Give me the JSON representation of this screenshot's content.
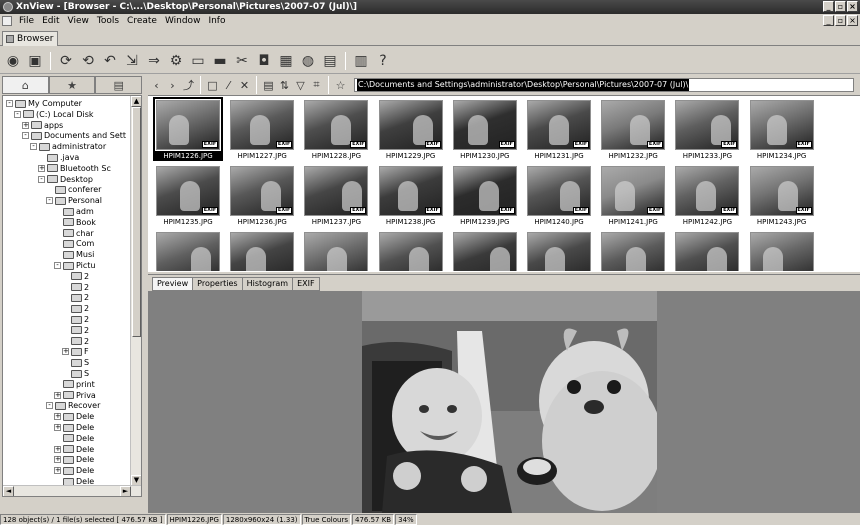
{
  "window": {
    "title": "XnView - [Browser - C:\\...\\Desktop\\Personal\\Pictures\\2007-07 (Jul)\\]"
  },
  "menu": [
    "File",
    "Edit",
    "View",
    "Tools",
    "Create",
    "Window",
    "Info"
  ],
  "doc_tab": "Browser",
  "path": "C:\\Documents and Settings\\administrator\\Desktop\\Personal\\Pictures\\2007-07 (Jul)\\",
  "tree": [
    {
      "label": "My Computer",
      "depth": 0,
      "exp": "-"
    },
    {
      "label": "(C:) Local Disk",
      "depth": 1,
      "exp": "-"
    },
    {
      "label": "apps",
      "depth": 2,
      "exp": "+"
    },
    {
      "label": "Documents and Sett",
      "depth": 2,
      "exp": "-"
    },
    {
      "label": "administrator",
      "depth": 3,
      "exp": "-"
    },
    {
      "label": ".java",
      "depth": 4,
      "exp": ""
    },
    {
      "label": "Bluetooth Sc",
      "depth": 4,
      "exp": "+"
    },
    {
      "label": "Desktop",
      "depth": 4,
      "exp": "-"
    },
    {
      "label": "conferer",
      "depth": 5,
      "exp": ""
    },
    {
      "label": "Personal",
      "depth": 5,
      "exp": "-"
    },
    {
      "label": "adm",
      "depth": 6,
      "exp": ""
    },
    {
      "label": "Book",
      "depth": 6,
      "exp": ""
    },
    {
      "label": "char",
      "depth": 6,
      "exp": ""
    },
    {
      "label": "Com",
      "depth": 6,
      "exp": ""
    },
    {
      "label": "Musi",
      "depth": 6,
      "exp": ""
    },
    {
      "label": "Pictu",
      "depth": 6,
      "exp": "-"
    },
    {
      "label": "2",
      "depth": 7,
      "exp": ""
    },
    {
      "label": "2",
      "depth": 7,
      "exp": ""
    },
    {
      "label": "2",
      "depth": 7,
      "exp": ""
    },
    {
      "label": "2",
      "depth": 7,
      "exp": ""
    },
    {
      "label": "2",
      "depth": 7,
      "exp": ""
    },
    {
      "label": "2",
      "depth": 7,
      "exp": ""
    },
    {
      "label": "2",
      "depth": 7,
      "exp": ""
    },
    {
      "label": "F",
      "depth": 7,
      "exp": "+"
    },
    {
      "label": "S",
      "depth": 7,
      "exp": ""
    },
    {
      "label": "S",
      "depth": 7,
      "exp": ""
    },
    {
      "label": "print",
      "depth": 6,
      "exp": ""
    },
    {
      "label": "Priva",
      "depth": 6,
      "exp": "+"
    },
    {
      "label": "Recover",
      "depth": 5,
      "exp": "-"
    },
    {
      "label": "Dele",
      "depth": 6,
      "exp": "+"
    },
    {
      "label": "Dele",
      "depth": 6,
      "exp": "+"
    },
    {
      "label": "Dele",
      "depth": 6,
      "exp": ""
    },
    {
      "label": "Dele",
      "depth": 6,
      "exp": "+"
    },
    {
      "label": "Dele",
      "depth": 6,
      "exp": "+"
    },
    {
      "label": "Dele",
      "depth": 6,
      "exp": "+"
    },
    {
      "label": "Dele",
      "depth": 6,
      "exp": ""
    }
  ],
  "thumbnails": [
    {
      "name": "HPIM1226.JPG",
      "tone": "#6c6c6c",
      "selected": true
    },
    {
      "name": "HPIM1227.JPG",
      "tone": "#5a5a5a"
    },
    {
      "name": "HPIM1228.JPG",
      "tone": "#4e4e4e"
    },
    {
      "name": "HPIM1229.JPG",
      "tone": "#3f3f3f"
    },
    {
      "name": "HPIM1230.JPG",
      "tone": "#2f2f2f"
    },
    {
      "name": "HPIM1231.JPG",
      "tone": "#4a4a4a"
    },
    {
      "name": "HPIM1232.JPG",
      "tone": "#7a7a7a"
    },
    {
      "name": "HPIM1233.JPG",
      "tone": "#5e5e5e"
    },
    {
      "name": "HPIM1234.JPG",
      "tone": "#6e6e6e"
    },
    {
      "name": "HPIM1235.JPG",
      "tone": "#4c4c4c"
    },
    {
      "name": "HPIM1236.JPG",
      "tone": "#585858"
    },
    {
      "name": "HPIM1237.JPG",
      "tone": "#464646"
    },
    {
      "name": "HPIM1238.JPG",
      "tone": "#3c3c3c"
    },
    {
      "name": "HPIM1239.JPG",
      "tone": "#2c2c2c"
    },
    {
      "name": "HPIM1240.JPG",
      "tone": "#555555"
    },
    {
      "name": "HPIM1241.JPG",
      "tone": "#8a8a8a"
    },
    {
      "name": "HPIM1242.JPG",
      "tone": "#626262"
    },
    {
      "name": "HPIM1243.JPG",
      "tone": "#737373"
    },
    {
      "name": "",
      "tone": "#5f5f5f"
    },
    {
      "name": "",
      "tone": "#444444"
    },
    {
      "name": "",
      "tone": "#6a6a6a"
    },
    {
      "name": "",
      "tone": "#505050"
    },
    {
      "name": "",
      "tone": "#3a3a3a"
    },
    {
      "name": "",
      "tone": "#494949"
    },
    {
      "name": "",
      "tone": "#5b5b5b"
    },
    {
      "name": "",
      "tone": "#4f4f4f"
    },
    {
      "name": "",
      "tone": "#666666"
    }
  ],
  "exif_badge": "EXIF",
  "preview_tabs": [
    "Preview",
    "Properties",
    "Histogram",
    "EXIF"
  ],
  "status": [
    "128 object(s) / 1 file(s) selected  [ 476.57 KB ]",
    "HPIM1226.JPG",
    "1280x960x24 (1.33)",
    "True Colours",
    "476.57 KB",
    "34%"
  ]
}
